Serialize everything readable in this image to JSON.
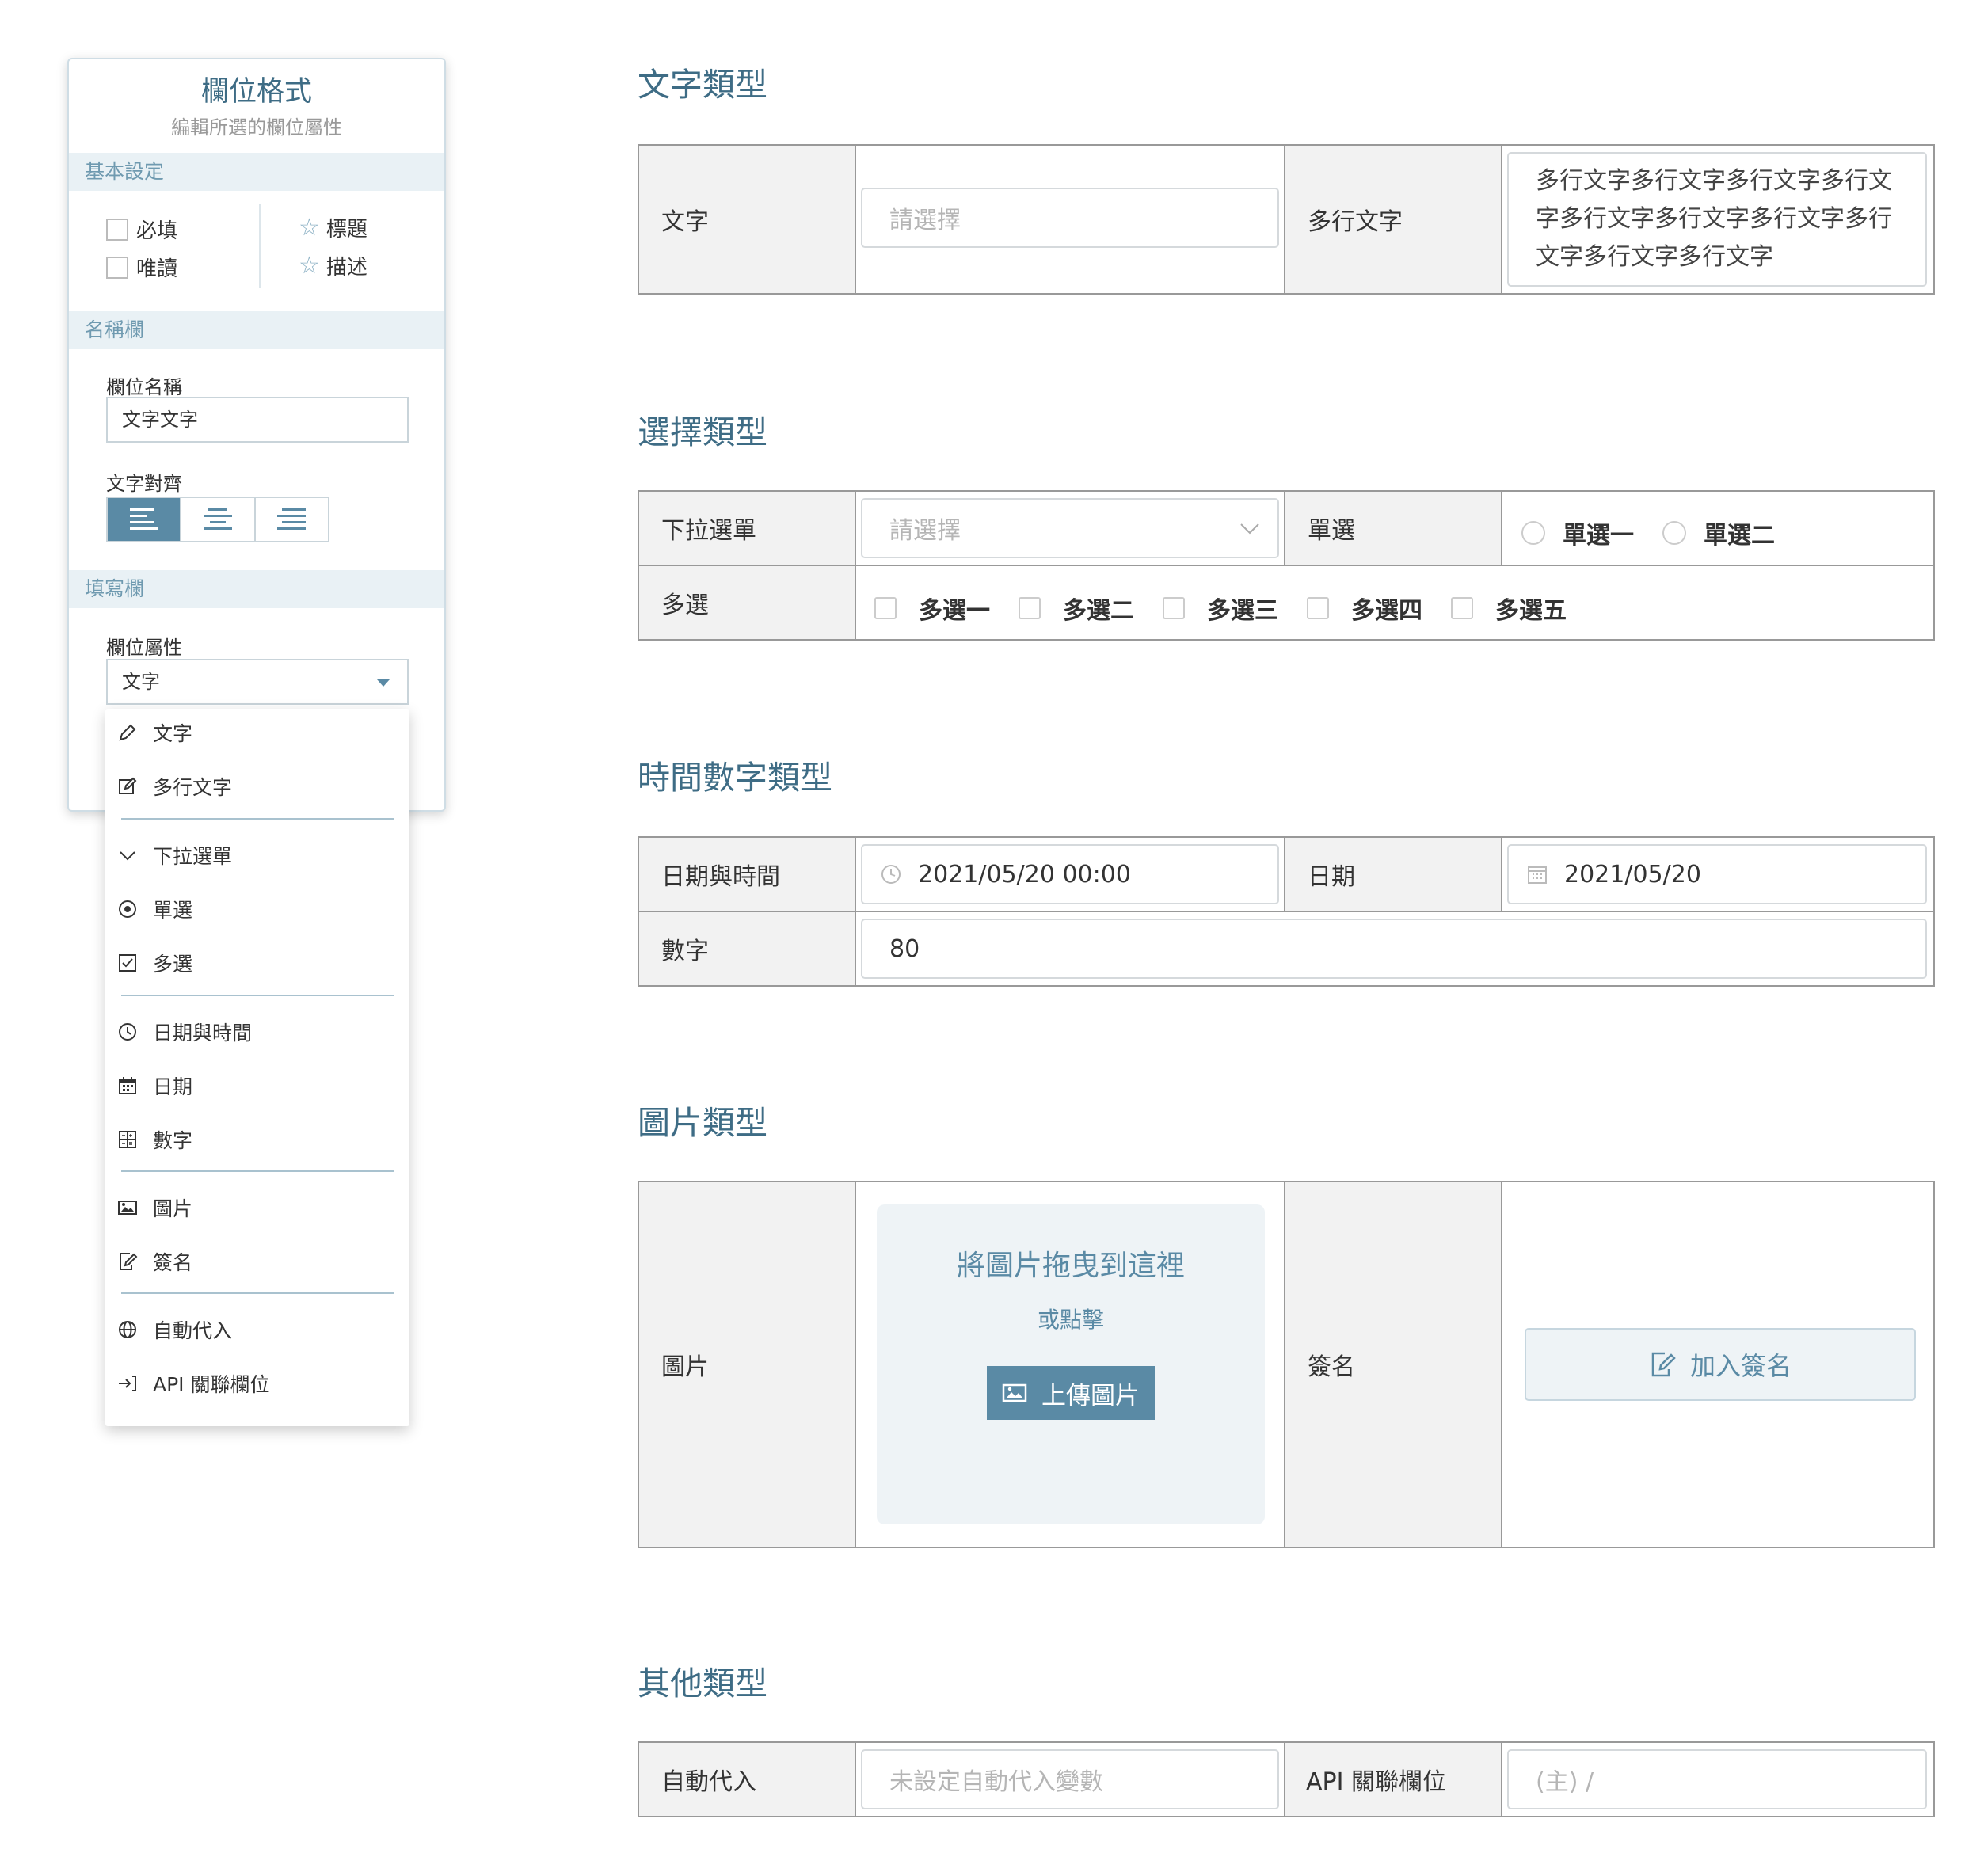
{
  "panel": {
    "title": "欄位格式",
    "subtitle": "編輯所選的欄位屬性",
    "basic_settings": {
      "label": "基本設定",
      "required": "必填",
      "readonly": "唯讀",
      "title": "標題",
      "description": "描述"
    },
    "name_section": {
      "label": "名稱欄",
      "field_name_label": "欄位名稱",
      "field_name_value": "文字文字",
      "align_label": "文字對齊",
      "align_selected": "left"
    },
    "fill_section": {
      "label": "填寫欄",
      "property_label": "欄位屬性",
      "property_value": "文字"
    }
  },
  "menu": {
    "items": [
      {
        "label": "文字",
        "icon": "pencil-icon"
      },
      {
        "label": "多行文字",
        "icon": "edit-icon"
      },
      {
        "label": "下拉選單",
        "icon": "chevron-down-icon"
      },
      {
        "label": "單選",
        "icon": "radio-icon"
      },
      {
        "label": "多選",
        "icon": "checkbox-icon"
      },
      {
        "label": "日期與時間",
        "icon": "clock-icon"
      },
      {
        "label": "日期",
        "icon": "calendar-icon"
      },
      {
        "label": "數字",
        "icon": "number-grid-icon"
      },
      {
        "label": "圖片",
        "icon": "image-icon"
      },
      {
        "label": "簽名",
        "icon": "signature-icon"
      },
      {
        "label": "自動代入",
        "icon": "globe-icon"
      },
      {
        "label": "API 關聯欄位",
        "icon": "api-link-icon"
      }
    ]
  },
  "sections": {
    "text": {
      "heading": "文字類型",
      "text_label": "文字",
      "text_placeholder": "請選擇",
      "multiline_label": "多行文字",
      "multiline_value": "多行文字多行文字多行文字多行文字多行文字多行文字多行文字多行文字多行文字多行文字"
    },
    "choice": {
      "heading": "選擇類型",
      "dropdown_label": "下拉選單",
      "dropdown_placeholder": "請選擇",
      "radio_label": "單選",
      "radio_options": [
        "單選一",
        "單選二"
      ],
      "multi_label": "多選",
      "multi_options": [
        "多選一",
        "多選二",
        "多選三",
        "多選四",
        "多選五"
      ]
    },
    "datetime": {
      "heading": "時間數字類型",
      "datetime_label": "日期與時間",
      "datetime_value": "2021/05/20 00:00",
      "date_label": "日期",
      "date_value": "2021/05/20",
      "number_label": "數字",
      "number_value": "80"
    },
    "image": {
      "heading": "圖片類型",
      "image_label": "圖片",
      "drop_text": "將圖片拖曳到這裡",
      "or_click": "或點擊",
      "upload_button": "上傳圖片",
      "signature_label": "簽名",
      "signature_button": "加入簽名"
    },
    "other": {
      "heading": "其他類型",
      "auto_label": "自動代入",
      "auto_placeholder": "未設定自動代入變數",
      "api_label": "API 關聯欄位",
      "api_placeholder": "(主) /"
    }
  },
  "colors": {
    "accent": "#5a8aa5",
    "heading": "#3e6c85",
    "section_bg": "#e9f1f5",
    "label_bg": "#f2f2f2"
  }
}
